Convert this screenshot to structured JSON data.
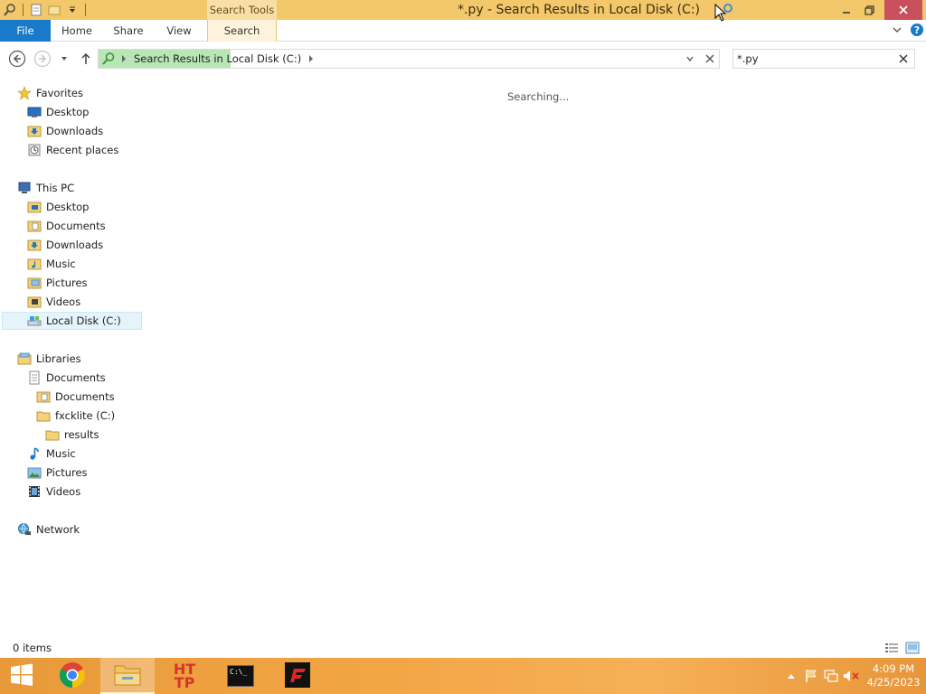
{
  "window": {
    "title": "*.py - Search Results in Local Disk (C:)",
    "contextual_tab_header": "Search Tools"
  },
  "ribbon": {
    "tabs": [
      {
        "label": "File"
      },
      {
        "label": "Home"
      },
      {
        "label": "Share"
      },
      {
        "label": "View"
      },
      {
        "label": "Search"
      }
    ]
  },
  "address": {
    "path": "Search Results in Local Disk (C:)"
  },
  "search": {
    "value": "*.py"
  },
  "nav": {
    "favorites": {
      "label": "Favorites",
      "items": [
        "Desktop",
        "Downloads",
        "Recent places"
      ]
    },
    "this_pc": {
      "label": "This PC",
      "items": [
        "Desktop",
        "Documents",
        "Downloads",
        "Music",
        "Pictures",
        "Videos",
        "Local Disk (C:)"
      ]
    },
    "libraries": {
      "label": "Libraries",
      "items": [
        "Documents",
        "Documents",
        "fxcklite (C:)",
        "results",
        "Music",
        "Pictures",
        "Videos"
      ]
    },
    "network": {
      "label": "Network"
    }
  },
  "content": {
    "status_message": "Searching..."
  },
  "status": {
    "item_count": "0 items"
  },
  "taskbar": {
    "http_label_line1": "HT",
    "http_label_line2": "TP",
    "cmd_label": "C:\\_",
    "clock_time": "4:09 PM",
    "clock_date": "4/25/2023"
  },
  "colors": {
    "title_bar": "#f3c86a",
    "file_tab": "#1979ca",
    "taskbar": "#f2a544",
    "address_progress": "#b8e7b5",
    "selected_item": "#e5f3fb"
  }
}
